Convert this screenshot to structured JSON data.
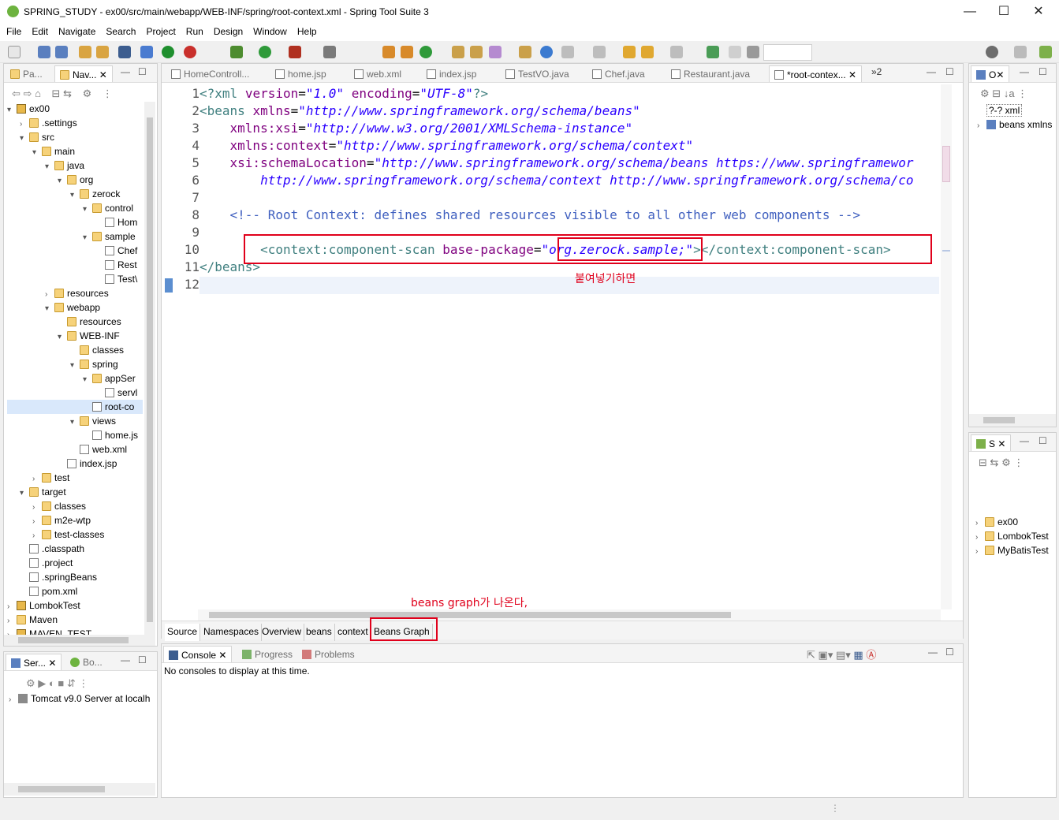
{
  "window": {
    "title": "SPRING_STUDY - ex00/src/main/webapp/WEB-INF/spring/root-context.xml - Spring Tool Suite 3",
    "minimize": "—",
    "maximize": "☐",
    "close": "✕"
  },
  "menu": [
    "File",
    "Edit",
    "Navigate",
    "Search",
    "Project",
    "Run",
    "Design",
    "Window",
    "Help"
  ],
  "left_tabs": {
    "tab1": "Pa...",
    "tab2": "Nav..."
  },
  "tree": [
    {
      "label": "ex00",
      "indent": 0,
      "arrow": "▾",
      "icon": "proj"
    },
    {
      "label": ".settings",
      "indent": 1,
      "arrow": "›",
      "icon": "fold"
    },
    {
      "label": "src",
      "indent": 1,
      "arrow": "▾",
      "icon": "fold"
    },
    {
      "label": "main",
      "indent": 2,
      "arrow": "▾",
      "icon": "fold"
    },
    {
      "label": "java",
      "indent": 3,
      "arrow": "▾",
      "icon": "fold"
    },
    {
      "label": "org",
      "indent": 4,
      "arrow": "▾",
      "icon": "fold"
    },
    {
      "label": "zerock",
      "indent": 5,
      "arrow": "▾",
      "icon": "fold"
    },
    {
      "label": "control",
      "indent": 6,
      "arrow": "▾",
      "icon": "fold"
    },
    {
      "label": "Hom",
      "indent": 7,
      "arrow": "",
      "icon": "file"
    },
    {
      "label": "sample",
      "indent": 6,
      "arrow": "▾",
      "icon": "fold"
    },
    {
      "label": "Chef",
      "indent": 7,
      "arrow": "",
      "icon": "file"
    },
    {
      "label": "Rest",
      "indent": 7,
      "arrow": "",
      "icon": "file"
    },
    {
      "label": "Test\\",
      "indent": 7,
      "arrow": "",
      "icon": "file"
    },
    {
      "label": "resources",
      "indent": 3,
      "arrow": "›",
      "icon": "fold"
    },
    {
      "label": "webapp",
      "indent": 3,
      "arrow": "▾",
      "icon": "fold"
    },
    {
      "label": "resources",
      "indent": 4,
      "arrow": "",
      "icon": "fold"
    },
    {
      "label": "WEB-INF",
      "indent": 4,
      "arrow": "▾",
      "icon": "fold"
    },
    {
      "label": "classes",
      "indent": 5,
      "arrow": "",
      "icon": "fold"
    },
    {
      "label": "spring",
      "indent": 5,
      "arrow": "▾",
      "icon": "fold"
    },
    {
      "label": "appSer",
      "indent": 6,
      "arrow": "▾",
      "icon": "fold"
    },
    {
      "label": "servl",
      "indent": 7,
      "arrow": "",
      "icon": "file"
    },
    {
      "label": "root-co",
      "indent": 6,
      "arrow": "",
      "icon": "file"
    },
    {
      "label": "views",
      "indent": 5,
      "arrow": "▾",
      "icon": "fold"
    },
    {
      "label": "home.js",
      "indent": 6,
      "arrow": "",
      "icon": "file"
    },
    {
      "label": "web.xml",
      "indent": 5,
      "arrow": "",
      "icon": "file"
    },
    {
      "label": "index.jsp",
      "indent": 4,
      "arrow": "",
      "icon": "file"
    },
    {
      "label": "test",
      "indent": 2,
      "arrow": "›",
      "icon": "fold"
    },
    {
      "label": "target",
      "indent": 1,
      "arrow": "▾",
      "icon": "fold"
    },
    {
      "label": "classes",
      "indent": 2,
      "arrow": "›",
      "icon": "fold"
    },
    {
      "label": "m2e-wtp",
      "indent": 2,
      "arrow": "›",
      "icon": "fold"
    },
    {
      "label": "test-classes",
      "indent": 2,
      "arrow": "›",
      "icon": "fold"
    },
    {
      "label": ".classpath",
      "indent": 1,
      "arrow": "",
      "icon": "file"
    },
    {
      "label": ".project",
      "indent": 1,
      "arrow": "",
      "icon": "file"
    },
    {
      "label": ".springBeans",
      "indent": 1,
      "arrow": "",
      "icon": "file"
    },
    {
      "label": "pom.xml",
      "indent": 1,
      "arrow": "",
      "icon": "file"
    },
    {
      "label": "LombokTest",
      "indent": 0,
      "arrow": "›",
      "icon": "proj"
    },
    {
      "label": "Maven",
      "indent": 0,
      "arrow": "›",
      "icon": "fold"
    },
    {
      "label": "MAVEN_TEST",
      "indent": 0,
      "arrow": "›",
      "icon": "proj"
    }
  ],
  "editor_tabs": [
    "HomeControll...",
    "home.jsp",
    "web.xml",
    "index.jsp",
    "TestVO.java",
    "Chef.java",
    "Restaurant.java",
    "*root-contex..."
  ],
  "editor_tabs_overflow": "»2",
  "code_lines": [
    "1",
    "2",
    "3",
    "4",
    "5",
    "6",
    "7",
    "8",
    "9",
    "10",
    "11",
    "12"
  ],
  "bottom_tabs": [
    "Source",
    "Namespaces",
    "Overview",
    "beans",
    "context",
    "Beans Graph"
  ],
  "annotations": {
    "paste": "붙여넣기하면",
    "graph": "beans graph가 나온다,"
  },
  "console": {
    "tabs": [
      "Console",
      "Progress",
      "Problems"
    ],
    "message": "No consoles to display at this time."
  },
  "servers": {
    "tab1": "Ser...",
    "tab2": "Bo...",
    "item": "Tomcat v9.0 Server at localh"
  },
  "outline": {
    "tab": "O",
    "items": [
      "?-? xml",
      "beans xmlns"
    ]
  },
  "spring": {
    "tab": "S",
    "items": [
      "ex00",
      "LombokTest",
      "MyBatisTest"
    ]
  }
}
